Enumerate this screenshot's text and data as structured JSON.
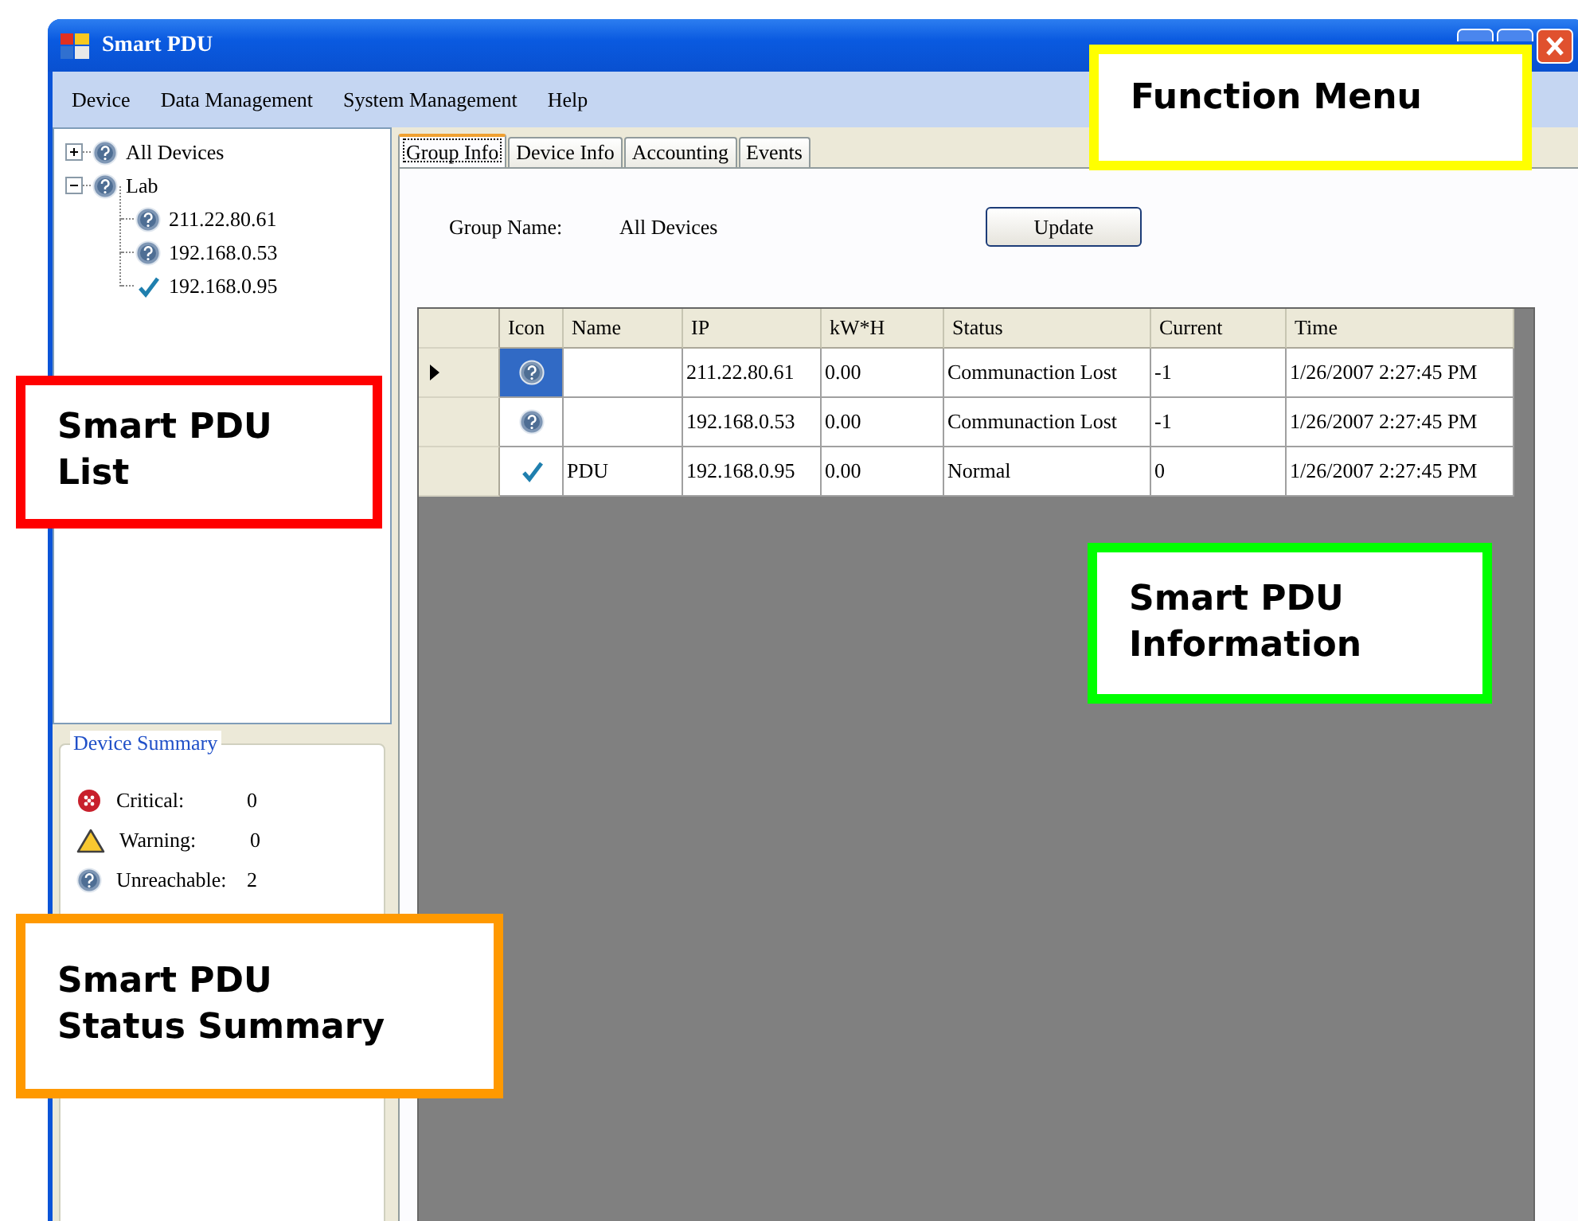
{
  "window": {
    "title": "Smart PDU"
  },
  "menu": [
    "Device",
    "Data Management",
    "System Management",
    "Help"
  ],
  "tree": [
    {
      "label": "All Devices",
      "kind": "unknown",
      "expanded": false
    },
    {
      "label": "Lab",
      "kind": "unknown",
      "expanded": true,
      "children": [
        {
          "label": "211.22.80.61",
          "kind": "unknown"
        },
        {
          "label": "192.168.0.53",
          "kind": "unknown"
        },
        {
          "label": "192.168.0.95",
          "kind": "normal"
        }
      ]
    }
  ],
  "summary": {
    "title": "Device Summary",
    "items": [
      {
        "kind": "critical",
        "label": "Critical:",
        "count": "0"
      },
      {
        "kind": "warning",
        "label": "Warning:",
        "count": "0"
      },
      {
        "kind": "unknown",
        "label": "Unreachable:",
        "count": "2"
      }
    ]
  },
  "tabs": [
    {
      "label": "Group Info",
      "selected": true
    },
    {
      "label": "Device Info",
      "selected": false
    },
    {
      "label": "Accounting",
      "selected": false
    },
    {
      "label": "Events",
      "selected": false
    }
  ],
  "group": {
    "label": "Group Name:",
    "value": "All Devices",
    "button": "Update"
  },
  "table": {
    "columns": [
      "Icon",
      "Name",
      "IP",
      "kW*H",
      "Status",
      "Current",
      "Time"
    ],
    "rows": [
      {
        "selected": true,
        "kind": "unknown",
        "cells": [
          "",
          "",
          "211.22.80.61",
          "0.00",
          "Communaction Lost",
          "-1",
          "1/26/2007 2:27:45 PM"
        ]
      },
      {
        "selected": false,
        "kind": "unknown",
        "cells": [
          "",
          "",
          "192.168.0.53",
          "0.00",
          "Communaction Lost",
          "-1",
          "1/26/2007 2:27:45 PM"
        ]
      },
      {
        "selected": false,
        "kind": "normal",
        "cells": [
          "",
          "PDU",
          "192.168.0.95",
          "0.00",
          "Normal",
          "0",
          "1/26/2007 2:27:45 PM"
        ]
      }
    ]
  },
  "callouts": [
    {
      "text": "Function Menu",
      "color": "#ffff00"
    },
    {
      "text": "Smart PDU\nList",
      "color": "#ff0000"
    },
    {
      "text": "Smart PDU\nInformation",
      "color": "#00ff00"
    },
    {
      "text": "Smart PDU\nStatus Summary",
      "color": "#ff9900"
    }
  ]
}
